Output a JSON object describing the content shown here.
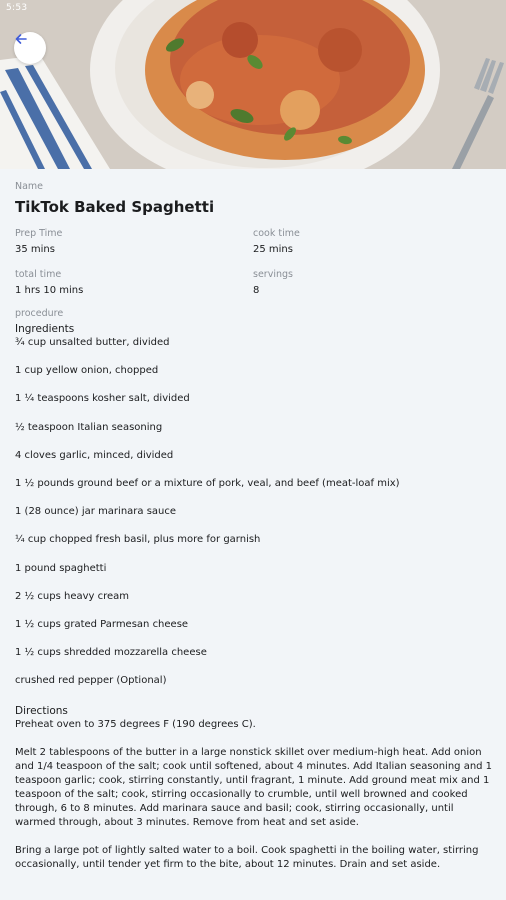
{
  "status_bar": {
    "time": "5:53"
  },
  "hero": {
    "image_description_icon": "spaghetti-photo"
  },
  "recipe": {
    "name_label": "Name",
    "name": "TikTok Baked Spaghetti",
    "prep_time_label": "Prep Time",
    "prep_time": "35 mins",
    "cook_time_label": "cook time",
    "cook_time": "25 mins",
    "total_time_label": "total time",
    "total_time": "1 hrs 10 mins",
    "servings_label": "servings",
    "servings": "8",
    "procedure_label": "procedure",
    "ingredients_heading": "Ingredients",
    "ingredients": [
      "¾ cup unsalted butter, divided",
      "1 cup yellow onion, chopped",
      "1 ¼ teaspoons kosher salt, divided",
      "½ teaspoon Italian seasoning",
      "4 cloves garlic, minced, divided",
      "1 ½ pounds ground beef or a mixture of pork, veal, and beef (meat-loaf mix)",
      "1 (28 ounce) jar marinara sauce",
      "¼ cup chopped fresh basil, plus more for garnish",
      "1 pound spaghetti",
      "2 ½ cups heavy cream",
      "1 ½ cups grated Parmesan cheese",
      "1 ½ cups shredded mozzarella cheese",
      "crushed red pepper (Optional)"
    ],
    "directions_heading": "Directions",
    "directions": [
      "Preheat oven to 375 degrees F (190 degrees C).",
      "Melt 2 tablespoons of the butter in a large nonstick skillet over medium-high heat. Add onion and 1/4 teaspoon of the salt; cook until softened, about 4 minutes. Add Italian seasoning and 1 teaspoon garlic; cook, stirring constantly, until fragrant, 1 minute. Add ground meat mix and 1 teaspoon of the salt; cook, stirring occasionally to crumble, until well browned and cooked through, 6 to 8 minutes. Add marinara sauce and basil; cook, stirring occasionally, until warmed through, about 3 minutes. Remove from heat and set aside.",
      "Bring a large pot of lightly salted water to a boil. Cook spaghetti in the boiling water, stirring occasionally, until tender yet firm to the bite, about 12 minutes. Drain and set aside."
    ]
  },
  "colors": {
    "background": "#f2f5f8",
    "accent": "#3f5bd8",
    "label": "#8a8f96"
  }
}
